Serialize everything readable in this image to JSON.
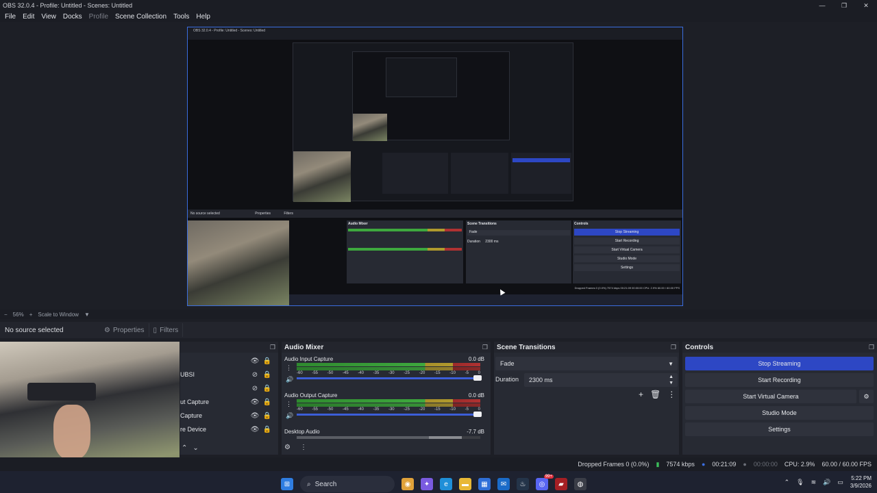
{
  "window": {
    "title": "OBS 32.0.4 - Profile: Untitled - Scenes: Untitled",
    "minimize": "—",
    "restore": "❐",
    "close": "✕"
  },
  "menu": {
    "file": "File",
    "edit": "Edit",
    "view": "View",
    "docks": "Docks",
    "profile": "Profile",
    "scene_collection": "Scene Collection",
    "tools": "Tools",
    "help": "Help"
  },
  "preview": {
    "nested_title": "OBS 32.0.4 - Profile: Untitled - Scenes: Untitled",
    "nested_no_source": "No source selected",
    "nested_properties": "Properties",
    "nested_filters": "Filters",
    "nested_audio_mixer": "Audio Mixer",
    "nested_scene_transitions": "Scene Transitions",
    "nested_controls": "Controls",
    "nested_stop_streaming": "Stop Streaming",
    "nested_start_recording": "Start Recording",
    "nested_start_virtual": "Start Virtual Camera",
    "nested_studio_mode": "Studio Mode",
    "nested_settings": "Settings",
    "nested_fade": "Fade",
    "nested_duration": "Duration",
    "nested_duration_val": "2300 ms",
    "nested_status": "Dropped Frames 0 (0.0%)   7574 kbps   00:21:09   00:00:00   CPU: 2.9%   60.00 / 60.00 FPS"
  },
  "zoom": {
    "minus": "−",
    "level": "56%",
    "plus": "+",
    "scale_label": "Scale to Window",
    "arrow": "▼"
  },
  "source_toolbar": {
    "no_source": "No source selected",
    "properties": "Properties",
    "filters": "Filters"
  },
  "sources": {
    "rows": [
      {
        "name": "",
        "vis": "👁",
        "lock": "🔒"
      },
      {
        "name": "UBSI",
        "vis": "⊘",
        "lock": "🔒"
      },
      {
        "name": "",
        "vis": "⊘",
        "lock": "🔒"
      },
      {
        "name": "ut Capture",
        "vis": "👁",
        "lock": "🔒"
      },
      {
        "name": "Capture",
        "vis": "👁",
        "lock": "🔒"
      },
      {
        "name": "re Device",
        "vis": "👁",
        "lock": "🔒"
      }
    ],
    "up": "⌃",
    "down": "⌄"
  },
  "audio_mixer": {
    "title": "Audio Mixer",
    "channels": [
      {
        "name": "Audio Input Capture",
        "db": "0.0 dB"
      },
      {
        "name": "Audio Output Capture",
        "db": "0.0 dB"
      },
      {
        "name": "Desktop Audio",
        "db": "-7.7 dB"
      }
    ],
    "scale": [
      "-60",
      "-55",
      "-50",
      "-45",
      "-40",
      "-35",
      "-30",
      "-25",
      "-20",
      "-15",
      "-10",
      "-5",
      "0"
    ]
  },
  "scene_transitions": {
    "title": "Scene Transitions",
    "transition": "Fade",
    "duration_label": "Duration",
    "duration_value": "2300 ms"
  },
  "controls": {
    "title": "Controls",
    "stop_streaming": "Stop Streaming",
    "start_recording": "Start Recording",
    "start_virtual_camera": "Start Virtual Camera",
    "studio_mode": "Studio Mode",
    "settings": "Settings"
  },
  "status": {
    "dropped_frames": "Dropped Frames 0 (0.0%)",
    "bitrate": "7574 kbps",
    "stream_time": "00:21:09",
    "record_time": "00:00:00",
    "cpu": "CPU: 2.9%",
    "fps": "60.00 / 60.00 FPS"
  },
  "taskbar": {
    "search": "Search",
    "time": "5:22 PM",
    "date": "3/9/2026",
    "badge": "99+"
  },
  "colors": {
    "accent": "#2d47c4",
    "selection_border": "#3b6ee0",
    "meter_green": "#3ea83e",
    "meter_yellow": "#b09a2d",
    "meter_red": "#b03232"
  }
}
